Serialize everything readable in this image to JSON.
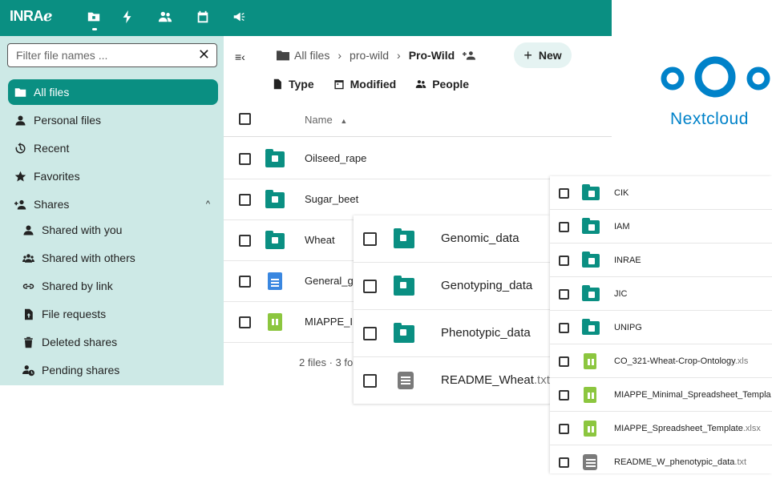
{
  "topbar": {
    "logo": "INRAℯ",
    "apps": [
      "files-icon",
      "activity-icon",
      "contacts-icon",
      "calendar-icon",
      "announcements-icon"
    ]
  },
  "sidebar": {
    "filter_placeholder": "Filter file names ...",
    "items": [
      {
        "label": "All files",
        "icon": "folder-icon"
      },
      {
        "label": "Personal files",
        "icon": "person-icon"
      },
      {
        "label": "Recent",
        "icon": "history-icon"
      },
      {
        "label": "Favorites",
        "icon": "star-icon"
      },
      {
        "label": "Shares",
        "icon": "share-icon"
      },
      {
        "label": "Shared with you",
        "icon": "person-icon"
      },
      {
        "label": "Shared with others",
        "icon": "group-icon"
      },
      {
        "label": "Shared by link",
        "icon": "link-icon"
      },
      {
        "label": "File requests",
        "icon": "file-upload-icon"
      },
      {
        "label": "Deleted shares",
        "icon": "trash-icon"
      },
      {
        "label": "Pending shares",
        "icon": "pending-icon"
      }
    ]
  },
  "main": {
    "breadcrumb": [
      "All files",
      "pro-wild",
      "Pro-Wild"
    ],
    "new_label": "New",
    "filters": [
      "Type",
      "Modified",
      "People"
    ],
    "name_header": "Name",
    "rows": [
      "Oilseed_rape",
      "Sugar_beet",
      "Wheat",
      "General_g",
      "MIAPPE_I"
    ],
    "summary": "2 files · 3 fo"
  },
  "panel2": {
    "rows": [
      {
        "name": "Genomic_data",
        "ext": ""
      },
      {
        "name": "Genotyping_data",
        "ext": ""
      },
      {
        "name": "Phenotypic_data",
        "ext": ""
      },
      {
        "name": "README_Wheat",
        "ext": ".txt"
      }
    ]
  },
  "panel3": {
    "rows": [
      {
        "name": "CIK",
        "ext": ""
      },
      {
        "name": "IAM",
        "ext": ""
      },
      {
        "name": "INRAE",
        "ext": ""
      },
      {
        "name": "JIC",
        "ext": ""
      },
      {
        "name": "UNIPG",
        "ext": ""
      },
      {
        "name": "CO_321-Wheat-Crop-Ontology",
        "ext": ".xls"
      },
      {
        "name": "MIAPPE_Minimal_Spreadsheet_Templa",
        "ext": ""
      },
      {
        "name": "MIAPPE_Spreadsheet_Template",
        "ext": ".xlsx"
      },
      {
        "name": "README_W_phenotypic_data",
        "ext": ".txt"
      }
    ]
  },
  "nextcloud": {
    "label": "Nextcloud",
    "color": "#0082c9"
  }
}
